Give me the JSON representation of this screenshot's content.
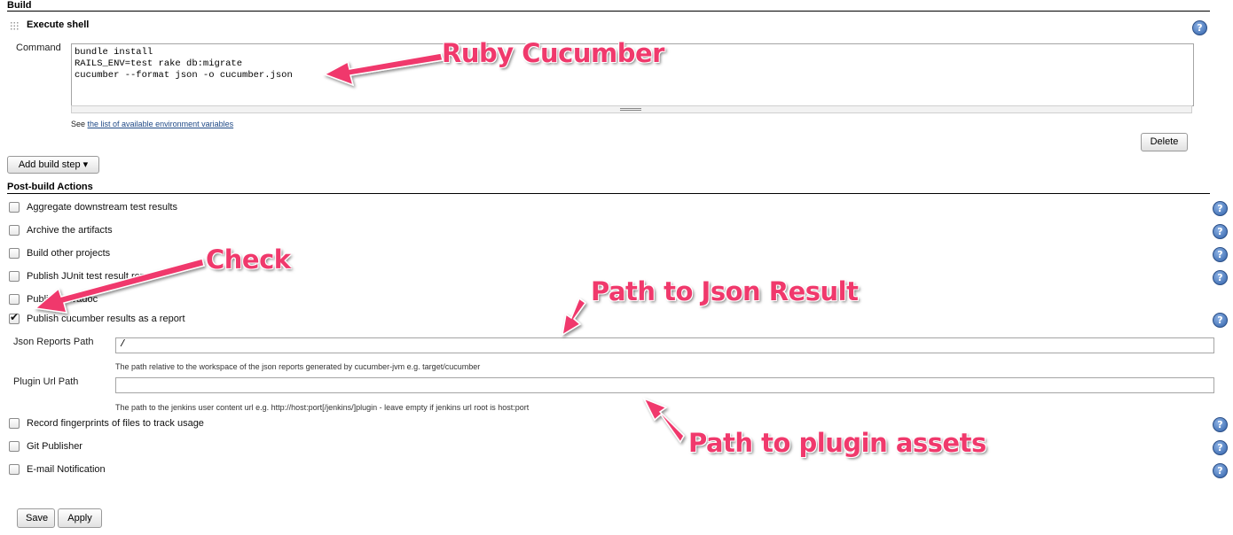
{
  "build": {
    "title": "Build",
    "step_title": "Execute shell",
    "command_label": "Command",
    "command_text": "bundle install\nRAILS_ENV=test rake db:migrate\ncucumber --format json -o cucumber.json",
    "see_prefix": "See",
    "env_link": "the list of available environment variables",
    "delete_label": "Delete",
    "add_step_label": "Add build step ▾"
  },
  "post_build": {
    "title": "Post-build Actions",
    "items": [
      {
        "label": "Aggregate downstream test results",
        "checked": false
      },
      {
        "label": "Archive the artifacts",
        "checked": false
      },
      {
        "label": "Build other projects",
        "checked": false
      },
      {
        "label": "Publish JUnit test result report",
        "checked": false
      },
      {
        "label": "Publish Javadoc",
        "checked": false
      },
      {
        "label": "Publish cucumber results as a report",
        "checked": true
      },
      {
        "label": "Record fingerprints of files to track usage",
        "checked": false
      },
      {
        "label": "Git Publisher",
        "checked": false
      },
      {
        "label": "E-mail Notification",
        "checked": false
      }
    ],
    "json_path_label": "Json Reports Path",
    "json_path_value": "/",
    "json_path_desc": "The path relative to the workspace of the json reports generated by cucumber-jvm e.g. target/cucumber",
    "plugin_url_label": "Plugin Url Path",
    "plugin_url_value": "",
    "plugin_url_desc": "The path to the jenkins user content url e.g. http://host:port[/jenkins/]plugin - leave empty if jenkins url root is host:port"
  },
  "footer": {
    "save_label": "Save",
    "apply_label": "Apply"
  },
  "help_glyph": "?",
  "annotations": {
    "ruby": "Ruby Cucumber",
    "check": "Check",
    "json_result": "Path to Json Result",
    "plugin_assets": "Path to plugin assets"
  },
  "colors": {
    "annotation": "#f0396c",
    "link": "#204a87",
    "help_icon": "#2e5fa8"
  }
}
